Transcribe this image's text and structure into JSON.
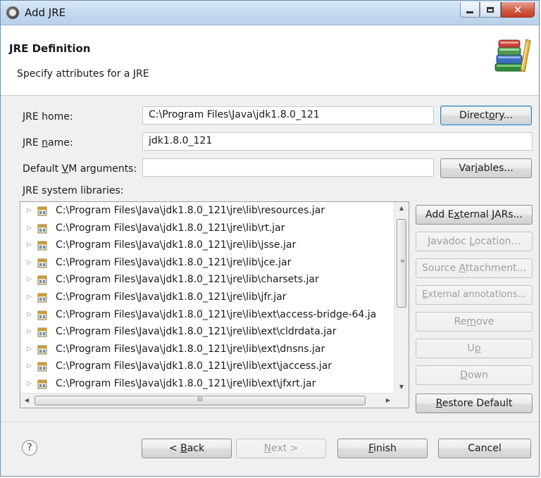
{
  "window": {
    "title": "Add JRE",
    "controls": [
      "minimize",
      "maximize",
      "close"
    ]
  },
  "header": {
    "title": "JRE Definition",
    "subtitle": "Specify attributes for a JRE",
    "icon": "books-icon"
  },
  "form": {
    "jre_home": {
      "label_pre": "",
      "label_mn": "J",
      "label_post": "RE home:",
      "value": "C:\\Program Files\\Java\\jdk1.8.0_121",
      "button_pre": "Direct",
      "button_mn": "o",
      "button_post": "ry..."
    },
    "jre_name": {
      "label_pre": "JRE ",
      "label_mn": "n",
      "label_post": "ame:",
      "value": "jdk1.8.0_121"
    },
    "vm_args": {
      "label_pre": "Default ",
      "label_mn": "V",
      "label_post": "M arguments:",
      "value": "",
      "button_pre": "Var",
      "button_mn": "i",
      "button_post": "ables..."
    }
  },
  "libraries": {
    "label": "JRE system libraries:",
    "items": [
      "C:\\Program Files\\Java\\jdk1.8.0_121\\jre\\lib\\resources.jar",
      "C:\\Program Files\\Java\\jdk1.8.0_121\\jre\\lib\\rt.jar",
      "C:\\Program Files\\Java\\jdk1.8.0_121\\jre\\lib\\jsse.jar",
      "C:\\Program Files\\Java\\jdk1.8.0_121\\jre\\lib\\jce.jar",
      "C:\\Program Files\\Java\\jdk1.8.0_121\\jre\\lib\\charsets.jar",
      "C:\\Program Files\\Java\\jdk1.8.0_121\\jre\\lib\\jfr.jar",
      "C:\\Program Files\\Java\\jdk1.8.0_121\\jre\\lib\\ext\\access-bridge-64.ja",
      "C:\\Program Files\\Java\\jdk1.8.0_121\\jre\\lib\\ext\\cldrdata.jar",
      "C:\\Program Files\\Java\\jdk1.8.0_121\\jre\\lib\\ext\\dnsns.jar",
      "C:\\Program Files\\Java\\jdk1.8.0_121\\jre\\lib\\ext\\jaccess.jar",
      "C:\\Program Files\\Java\\jdk1.8.0_121\\jre\\lib\\ext\\jfxrt.jar"
    ],
    "hscroll_grip": "III"
  },
  "side_buttons": {
    "add_external_jars": {
      "pre": "Add E",
      "mn": "x",
      "post": "ternal JARs..."
    },
    "javadoc_location": {
      "pre": "Javadoc ",
      "mn": "L",
      "post": "ocation..."
    },
    "source_attachment": {
      "pre": "Source ",
      "mn": "A",
      "post": "ttachment..."
    },
    "external_annotations": {
      "pre": "",
      "mn": "E",
      "post": "xternal annotations..."
    },
    "remove": {
      "pre": "Re",
      "mn": "m",
      "post": "ove"
    },
    "up": {
      "pre": "U",
      "mn": "p",
      "post": ""
    },
    "down": {
      "pre": "",
      "mn": "D",
      "post": "own"
    },
    "restore_default": {
      "pre": "",
      "mn": "R",
      "post": "estore Default"
    }
  },
  "footer": {
    "help": "?",
    "back": {
      "pre": "< ",
      "mn": "B",
      "post": "ack"
    },
    "next": {
      "pre": "",
      "mn": "N",
      "post": "ext >"
    },
    "finish": {
      "pre": "",
      "mn": "F",
      "post": "inish"
    },
    "cancel": "Cancel"
  },
  "colors": {
    "dialog_bg": "#f0f0f0",
    "header_bg": "#ffffff",
    "close_button": "#c43b22",
    "default_button_border": "#3c7fb1",
    "disabled_text": "#a0a0a0"
  }
}
